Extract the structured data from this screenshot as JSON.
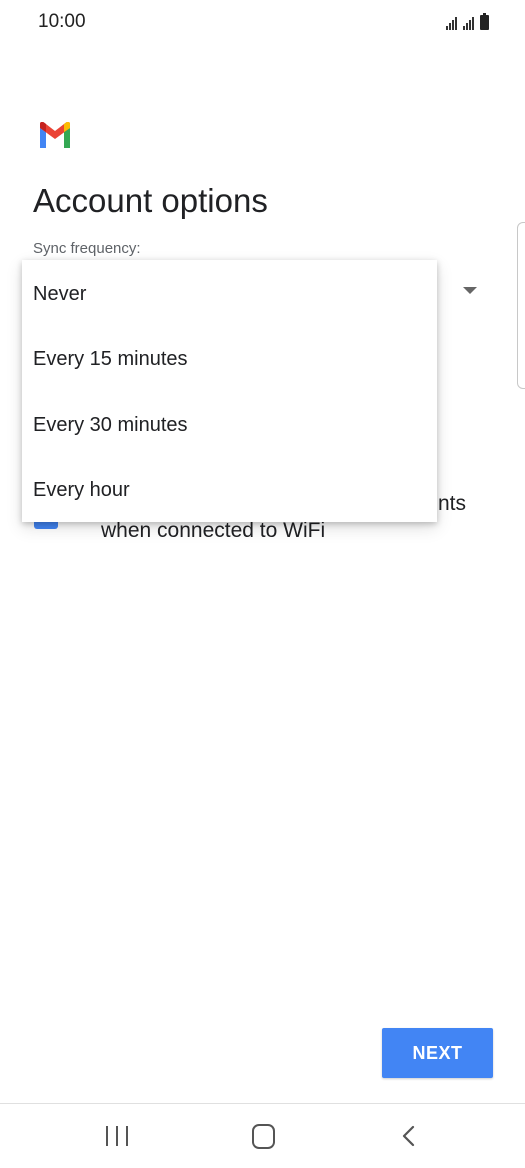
{
  "status_bar": {
    "time": "10:00",
    "signal_icon": "signal-bars-icon",
    "battery_icon": "battery-icon"
  },
  "app": {
    "logo_icon": "gmail-logo-icon",
    "title": "Account options"
  },
  "sync": {
    "label": "Sync frequency:",
    "options": [
      {
        "label": "Never"
      },
      {
        "label": "Every 15 minutes"
      },
      {
        "label": "Every 30 minutes"
      },
      {
        "label": "Every hour"
      }
    ]
  },
  "background_option": {
    "line1_fragment": "nts",
    "line2": "when connected to WiFi"
  },
  "actions": {
    "next_label": "NEXT"
  },
  "colors": {
    "accent": "#4285f4",
    "gmail_red": "#ea4335",
    "gmail_blue": "#4285f4",
    "gmail_green": "#34a853",
    "gmail_yellow": "#fbbc04"
  }
}
